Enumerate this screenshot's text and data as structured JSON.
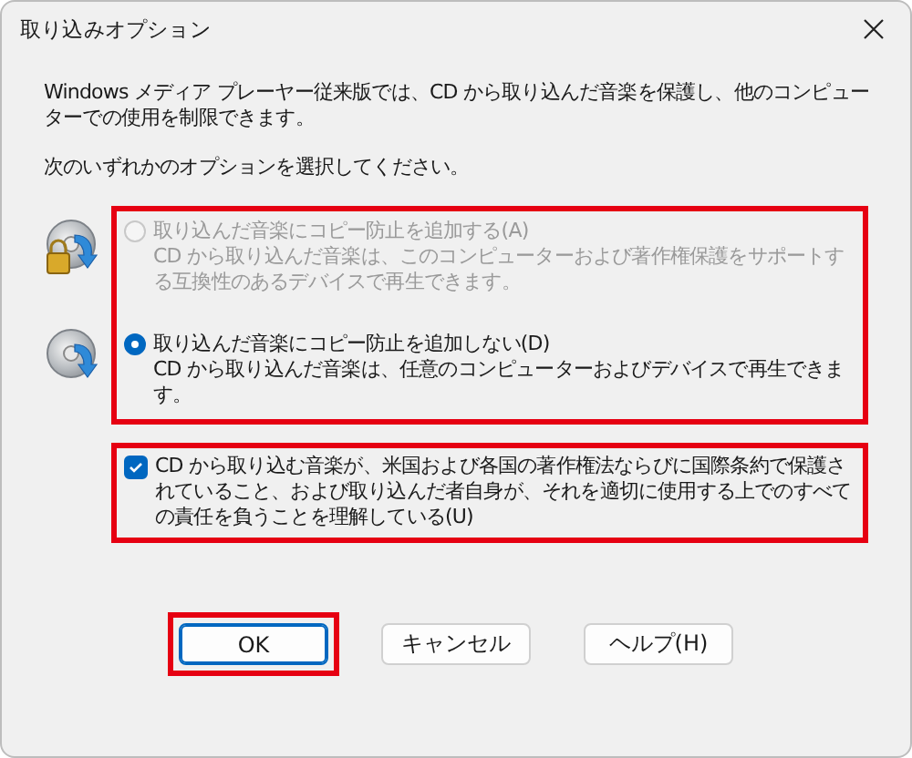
{
  "window": {
    "title": "取り込みオプション"
  },
  "intro": "Windows メディア プレーヤー従来版では、CD から取り込んだ音楽を保護し、他のコンピューターでの使用を制限できます。",
  "prompt": "次のいずれかのオプションを選択してください。",
  "options_highlighted": true,
  "options": [
    {
      "kind": "locked",
      "label": "取り込んだ音楽にコピー防止を追加する(A)",
      "description": "CD から取り込んだ音楽は、このコンピューターおよび著作権保護をサポートする互換性のあるデバイスで再生できます。",
      "selected": false,
      "disabled": true
    },
    {
      "kind": "plain",
      "label": "取り込んだ音楽にコピー防止を追加しない(D)",
      "description": "CD から取り込んだ音楽は、任意のコンピューターおよびデバイスで再生できます。",
      "selected": true,
      "disabled": false
    }
  ],
  "agreement": {
    "label": "CD から取り込む音楽が、米国および各国の著作権法ならびに国際条約で保護されていること、および取り込んだ者自身が、それを適切に使用する上でのすべての責任を負うことを理解している(U)",
    "checked": true,
    "highlighted": true
  },
  "buttons": [
    {
      "label": "OK",
      "default": true,
      "highlighted": true
    },
    {
      "label": "キャンセル",
      "default": false,
      "highlighted": false
    },
    {
      "label": "ヘルプ(H)",
      "default": false,
      "highlighted": false
    }
  ]
}
